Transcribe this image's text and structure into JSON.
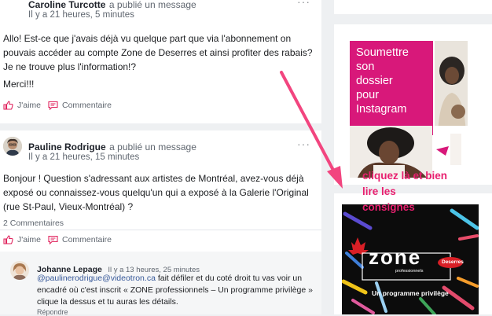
{
  "post1": {
    "author": "Caroline Turcotte",
    "verb": "a publié un message",
    "time": "Il y a 21 heures, 5 minutes",
    "body_lines": [
      "Allo! Est-ce que j'avais déjà vu quelque part que via l'abonnement on",
      "pouvais accéder au compte Zone de Deserres et ainsi profiter des rabais?",
      "Je ne trouve plus l'information!?"
    ],
    "body_line2": "Merci!!!",
    "like_label": "J'aime",
    "comment_label": "Commentaire",
    "menu": "···"
  },
  "post2": {
    "author": "Pauline Rodrigue",
    "verb": "a publié un message",
    "time": "Il y a 21 heures, 15 minutes",
    "body_lines": [
      "Bonjour ! Question s'adressant aux artistes de Montréal, avez-vous déjà",
      "exposé ou connaissez-vous quelqu'un qui a exposé à la Galerie l'Original",
      "(rue St-Paul, Vieux-Montréal) ?"
    ],
    "comments_count": "2 Commentaires",
    "like_label": "J'aime",
    "comment_label": "Commentaire",
    "menu": "···"
  },
  "reply": {
    "author": "Johanne Lepage",
    "time": "Il y a 13 heures, 25 minutes",
    "mention": "@paulinerodrigue@videotron.ca",
    "text_first": " fait défiler et du coté droit tu vas voir un",
    "text_lines": [
      "encadré où c'est inscrit « ZONE professionnels – Un programme privilège »",
      "clique la dessus et tu auras les détails."
    ],
    "reply_label": "Répondre"
  },
  "instagram_ad": {
    "lines": [
      "Soumettre",
      "son",
      "dossier",
      "pour",
      "Instagram"
    ]
  },
  "zone_ad": {
    "annotation_lines": [
      "cliquez là et bien",
      "lire les",
      "consignes"
    ],
    "logo": "zone",
    "logo_sub": "professionnels",
    "brand": "Deserres",
    "tagline": "Un programme privilège"
  },
  "colors": {
    "magenta": "#d8187a",
    "arrow_pink": "#f2457f",
    "link": "#365899",
    "action_icon": "#e0245e"
  }
}
